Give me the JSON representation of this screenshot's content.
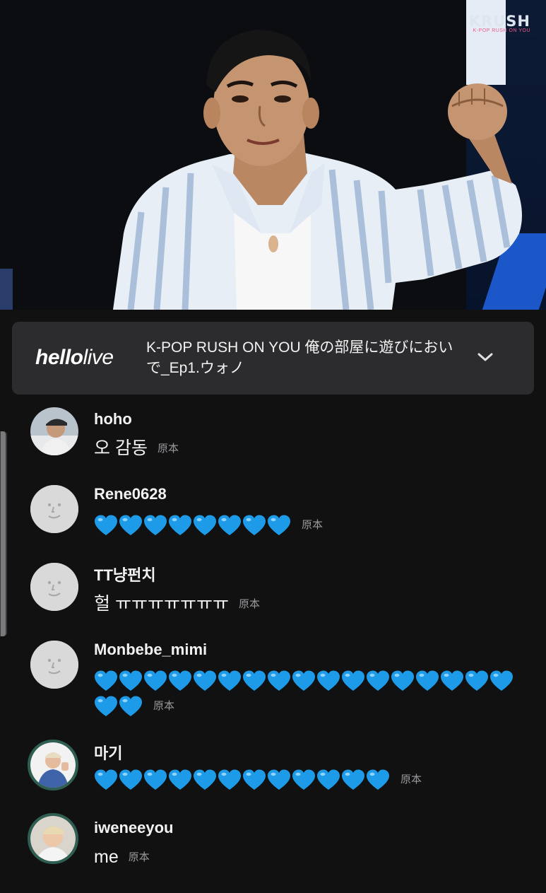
{
  "video": {
    "logo_main": "KRUSH",
    "logo_sub": "K-POP RUSH ON YOU"
  },
  "banner": {
    "brand_bold": "hello",
    "brand_light": "live",
    "title": "K-POP RUSH ON YOU 俺の部屋に遊びにおいで_Ep1.ウォノ",
    "chevron_icon": "chevron-down-icon"
  },
  "comments": [
    {
      "username": "hoho",
      "text": "오 감동",
      "hearts": 0,
      "orig": "原本",
      "avatar": "photo-user"
    },
    {
      "username": "Rene0628",
      "text": "",
      "hearts": 8,
      "orig": "原本",
      "avatar": "default-face"
    },
    {
      "username": "TT냥펀치",
      "text": "헐 ㅠㅠㅠㅠㅠㅠㅠ",
      "hearts": 0,
      "orig": "原本",
      "avatar": "default-face"
    },
    {
      "username": "Monbebe_mimi",
      "text": "",
      "hearts": 19,
      "orig": "原本",
      "avatar": "default-face"
    },
    {
      "username": "마기",
      "text": "",
      "hearts": 12,
      "orig": "原本",
      "avatar": "photo-user"
    },
    {
      "username": "iweneeyou",
      "text": "me",
      "hearts": 0,
      "orig": "原本",
      "avatar": "photo-user"
    }
  ],
  "colors": {
    "heart": "#1e9be8",
    "background": "#111112",
    "banner": "#2c2c2e",
    "secondary_text": "#9a9a9c"
  }
}
